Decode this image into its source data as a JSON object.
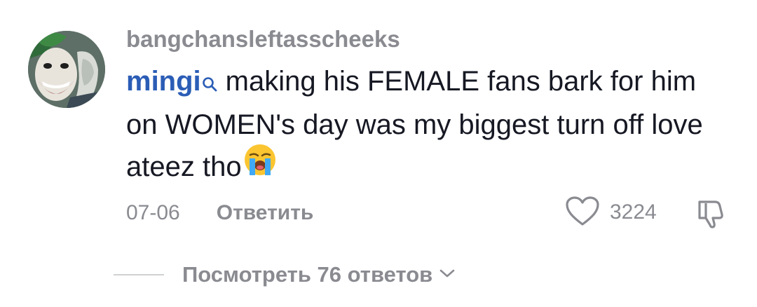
{
  "comment": {
    "username": "bangchansleftasscheeks",
    "mention": "mingi",
    "text": "making his FEMALE fans bark for him on WOMEN's day was my biggest turn off love ateez tho",
    "emoji": "loudly-crying-face",
    "date": "07-06",
    "reply_label": "Ответить",
    "like_count": "3224",
    "view_replies_label": "Посмотреть 76 ответов"
  },
  "icons": {
    "mention": "search-icon",
    "like": "heart-outline-icon",
    "dislike": "thumbs-down-icon",
    "expand": "chevron-down-icon"
  },
  "colors": {
    "text": "#161823",
    "muted": "#8a8b91",
    "mention": "#2b5db6",
    "divider": "#d0d1d3"
  }
}
